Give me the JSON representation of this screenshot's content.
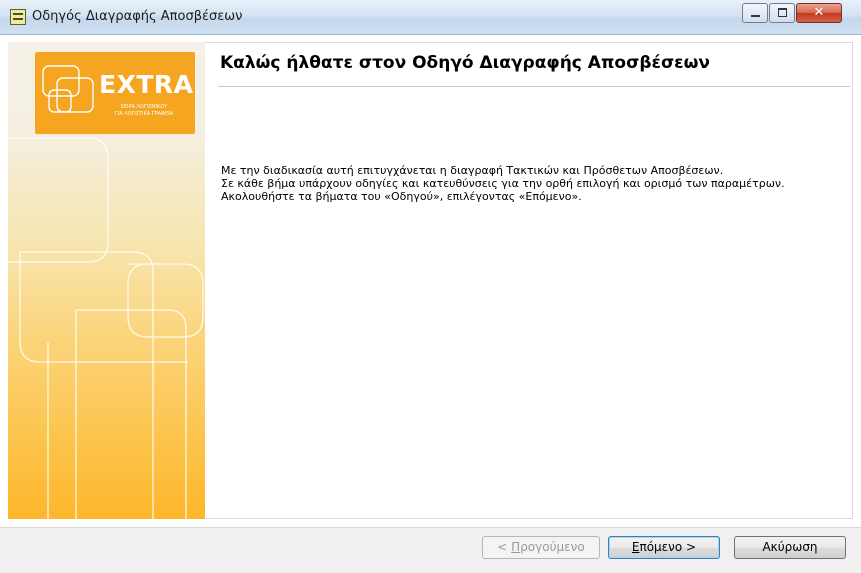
{
  "window": {
    "title": "Οδηγός Διαγραφής Αποσβέσεων",
    "icon": "wizard-app-icon",
    "controls": {
      "minimize": "minimize-icon",
      "maximize": "maximize-icon",
      "close": "✕"
    }
  },
  "sidebar": {
    "logo_text": "EXTRA",
    "logo_subtitle_line1": "ΣΕΙΡΑ ΛΟΓΙΣΜΙΚΟΥ",
    "logo_subtitle_line2": "ΓΙΑ ΛΟΓΙΣΤΙΚΑ ΓΡΑΦΕΙΑ"
  },
  "main": {
    "title": "Καλώς ήλθατε στον Οδηγό Διαγραφής Αποσβέσεων",
    "description": [
      "Με την διαδικασία αυτή επιτυγχάνεται η διαγραφή Τακτικών και Πρόσθετων Αποσβέσεων.",
      "Σε κάθε βήμα υπάρχουν οδηγίες και κατευθύνσεις για την ορθή επιλογή και ορισμό των παραμέτρων.",
      "Ακολουθήστε τα βήματα του «Οδηγού», επιλέγοντας «Επόμενο»."
    ]
  },
  "buttons": {
    "prev_mnemonic": "Π",
    "prev_rest": "ρογούμενο",
    "prev_prefix": "< ",
    "next_mnemonic": "Ε",
    "next_rest": "πόμενο >",
    "cancel": "Ακύρωση"
  },
  "colors": {
    "accent_orange": "#f5a51f",
    "focus_blue": "#3c7fb1"
  }
}
